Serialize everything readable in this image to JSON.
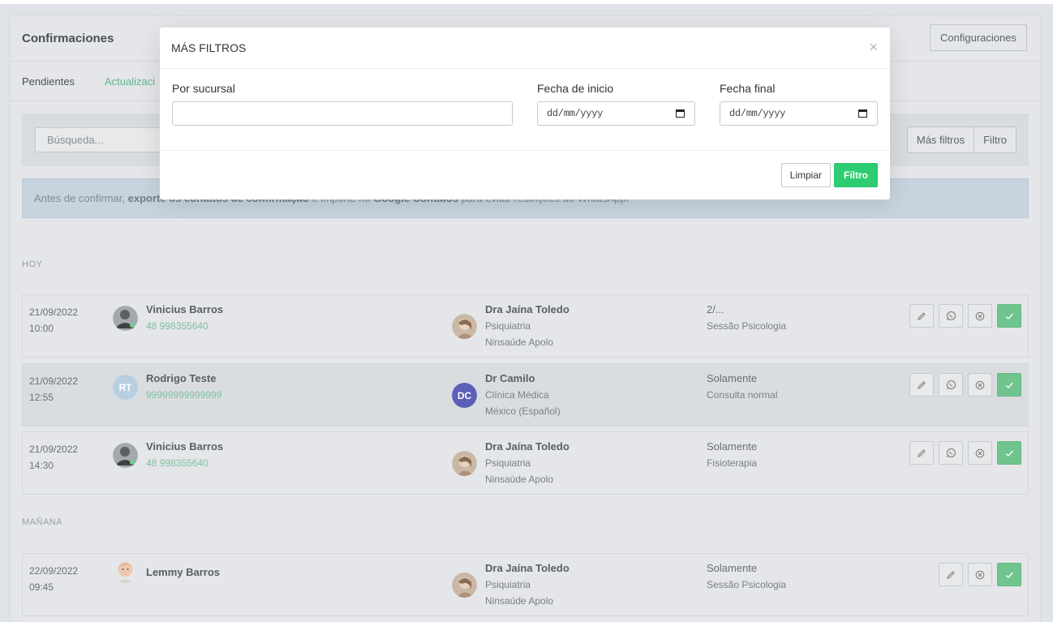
{
  "header": {
    "title": "Confirmaciones",
    "config_label": "Configuraciones"
  },
  "tabs": [
    {
      "label": "Pendientes"
    },
    {
      "label": "Actualizaci"
    }
  ],
  "search": {
    "placeholder": "Búsqueda...",
    "more_filters_label": "Más filtros",
    "filter_label": "Filtro"
  },
  "alert": {
    "prefix": "Antes de confirmar, ",
    "bold1": "exporte os contatos de confirmação",
    "middle": " e importe no ",
    "bold2": "Google Contatos",
    "suffix": " para evitar restrições do WhatsApp."
  },
  "sections": {
    "today": "HOY",
    "tomorrow": "MAÑANA"
  },
  "appointments": [
    {
      "date": "21/09/2022",
      "time": "10:00",
      "patient_name": "Vinicius Barros",
      "patient_phone": "48 998355640",
      "doctor_name": "Dra Jaína Toledo",
      "specialty": "Psiquiatria",
      "location": "Ninsaúde Apolo",
      "session_title": "2/...",
      "session_type": "Sessão Psicologia"
    },
    {
      "date": "21/09/2022",
      "time": "12:55",
      "patient_name": "Rodrigo Teste",
      "patient_phone": "99999999999999",
      "patient_initials": "RT",
      "doctor_name": "Dr Camilo",
      "doctor_initials": "DC",
      "specialty": "Clínica Médica",
      "location": "México (Español)",
      "session_title": "Solamente",
      "session_type": "Consulta normal"
    },
    {
      "date": "21/09/2022",
      "time": "14:30",
      "patient_name": "Vinicius Barros",
      "patient_phone": "48 998355640",
      "doctor_name": "Dra Jaína Toledo",
      "specialty": "Psiquiatria",
      "location": "Ninsaúde Apolo",
      "session_title": "Solamente",
      "session_type": "Fisioterapia"
    },
    {
      "date": "22/09/2022",
      "time": "09:45",
      "patient_name": "Lemmy Barros",
      "doctor_name": "Dra Jaína Toledo",
      "specialty": "Psiquiatria",
      "location": "Ninsaúde Apolo",
      "session_title": "Solamente",
      "session_type": "Sessão Psicologia"
    }
  ],
  "modal": {
    "title": "MÁS FILTROS",
    "close": "×",
    "branch_label": "Por sucursal",
    "branch_value": "",
    "start_label": "Fecha de inicio",
    "start_value": "dd/mm/yyyy",
    "end_label": "Fecha final",
    "end_value": "dd/mm/yyyy",
    "clear_label": "Limpiar",
    "filter_label": "Filtro"
  },
  "colors": {
    "accent_green": "#2ecc71",
    "confirm_green": "#70c58f",
    "phone_green": "#7fc2a0",
    "initials_rt": "#b7cfe0",
    "initials_dc": "#5b5fb8"
  },
  "icons": {
    "edit": "pencil-icon",
    "whatsapp": "whatsapp-icon",
    "cancel": "cancel-circle-icon",
    "confirm": "check-icon",
    "calendar": "calendar-icon"
  }
}
